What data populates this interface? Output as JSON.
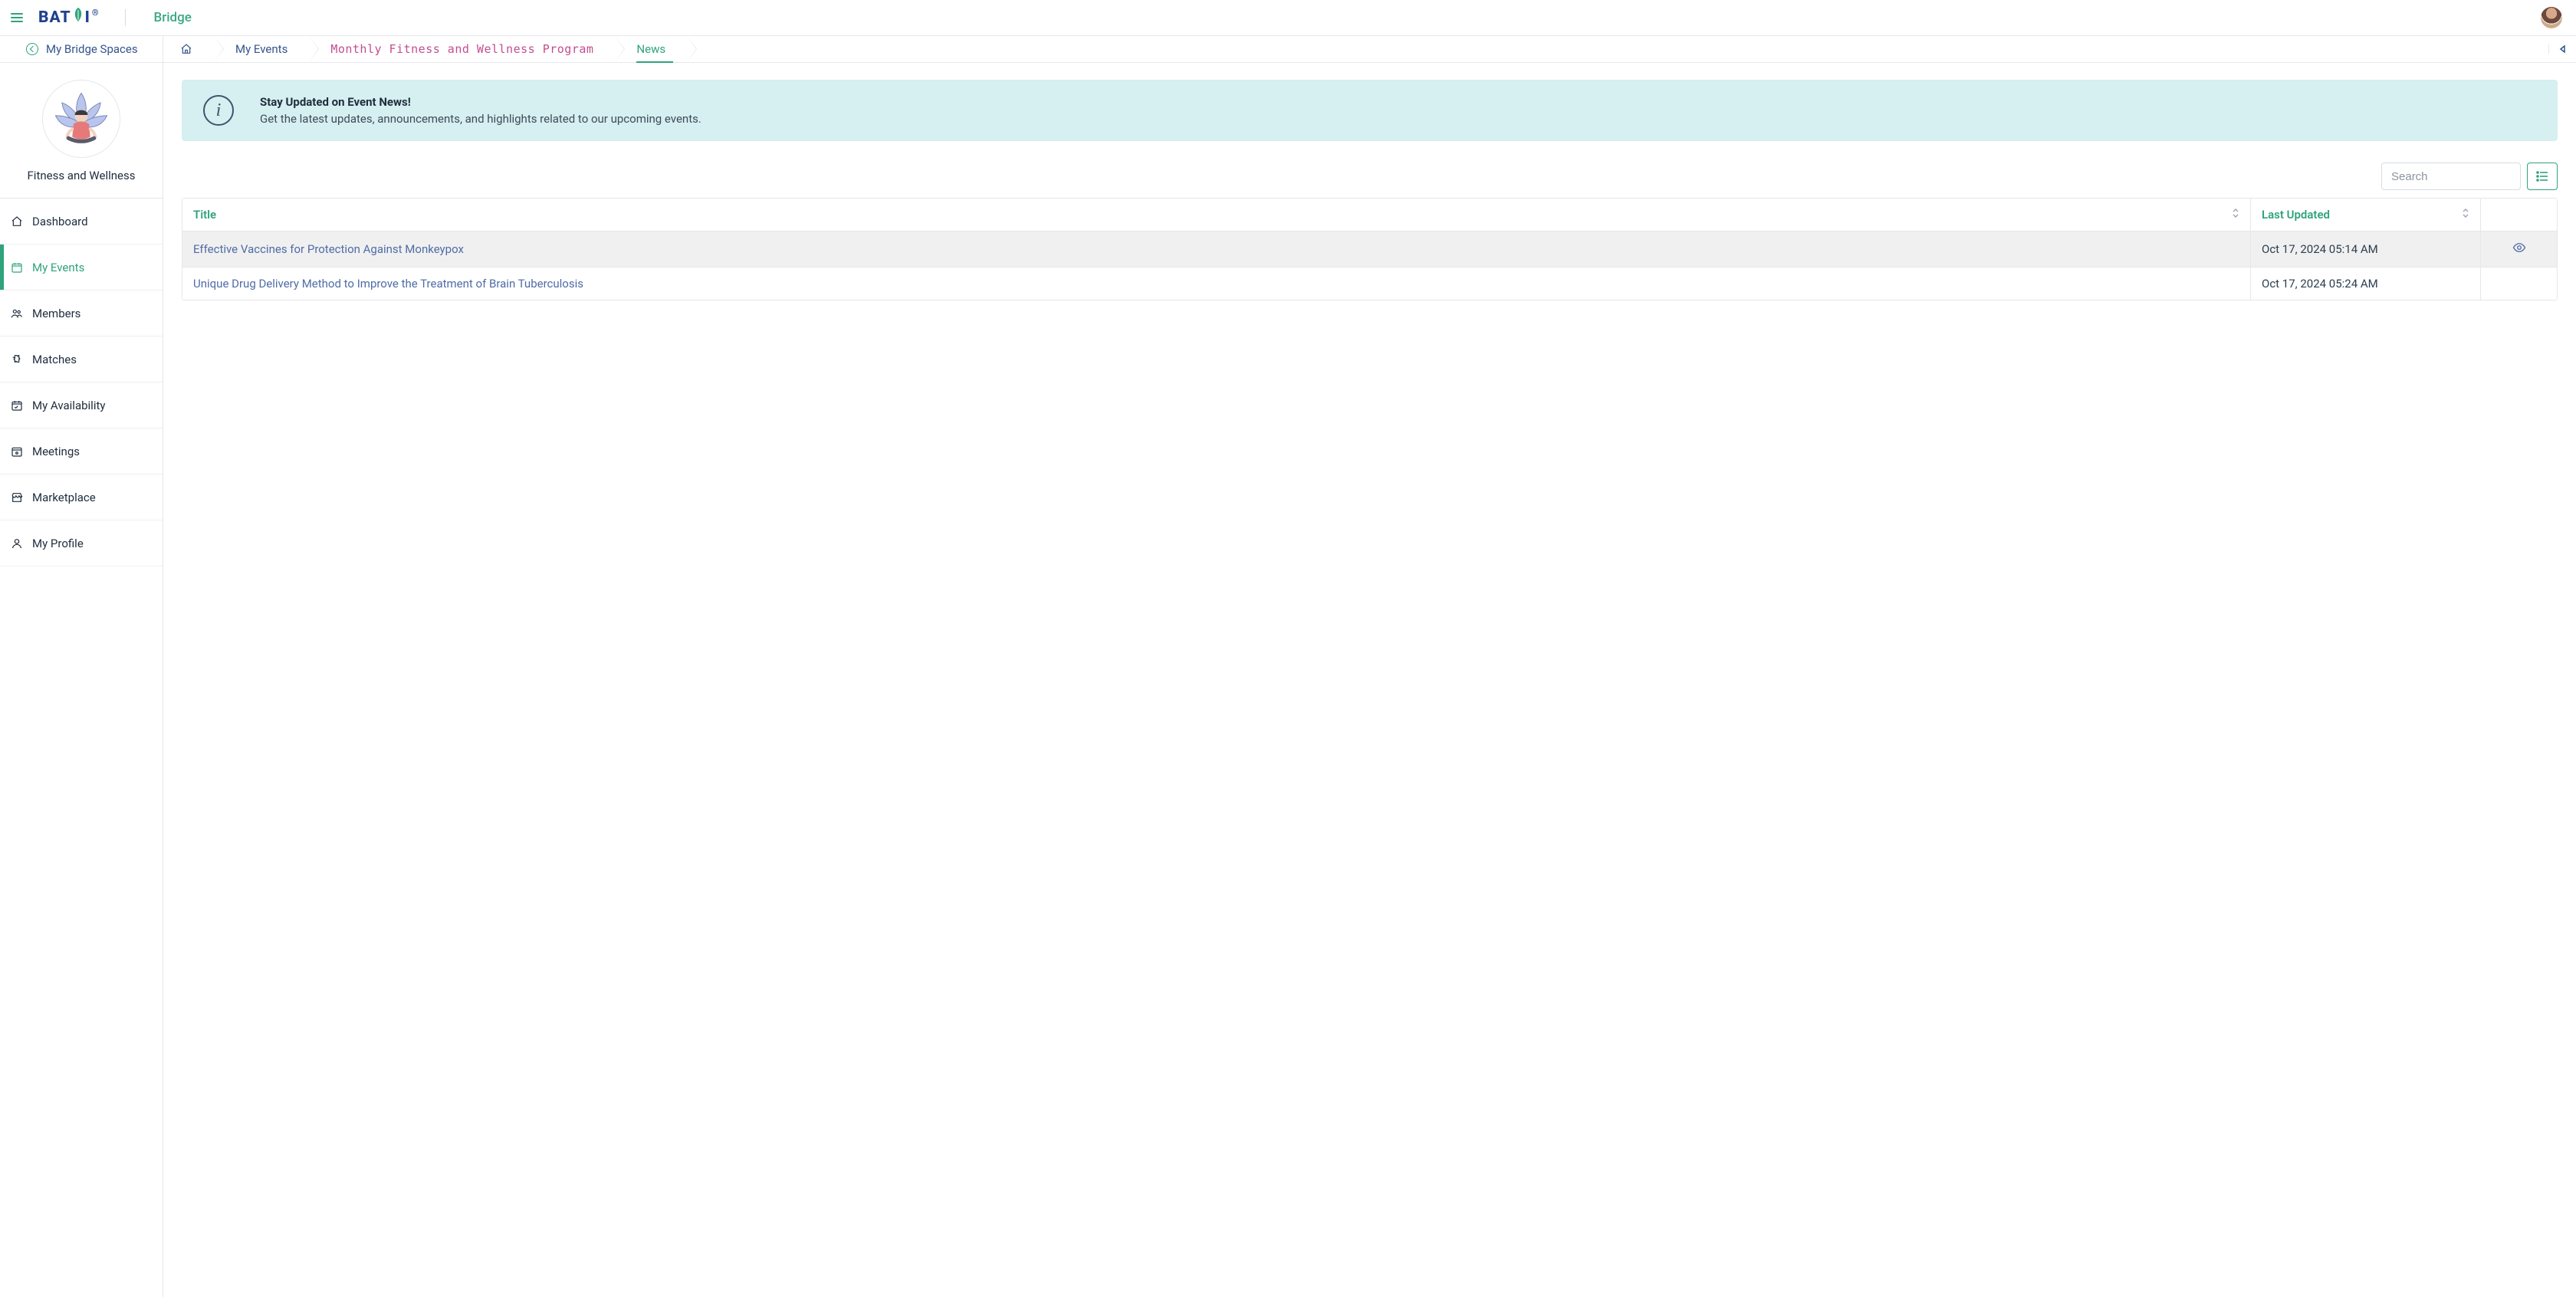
{
  "header": {
    "logo_text_prefix": "BAT",
    "logo_text_suffix": "I",
    "logo_registered": "®",
    "app_name": "Bridge"
  },
  "backlink": {
    "label": "My Bridge Spaces"
  },
  "breadcrumb": {
    "items": [
      {
        "label": "",
        "kind": "home"
      },
      {
        "label": "My Events",
        "kind": "link"
      },
      {
        "label": "Monthly Fitness and Wellness Program",
        "kind": "mono"
      },
      {
        "label": "News",
        "kind": "active"
      }
    ]
  },
  "sidebar": {
    "profile_name": "Fitness and Wellness",
    "items": [
      {
        "label": "Dashboard",
        "icon": "home-icon",
        "active": false
      },
      {
        "label": "My Events",
        "icon": "calendar-icon",
        "active": true
      },
      {
        "label": "Members",
        "icon": "users-icon",
        "active": false
      },
      {
        "label": "Matches",
        "icon": "puzzle-icon",
        "active": false
      },
      {
        "label": "My Availability",
        "icon": "availability-icon",
        "active": false
      },
      {
        "label": "Meetings",
        "icon": "meetings-icon",
        "active": false
      },
      {
        "label": "Marketplace",
        "icon": "store-icon",
        "active": false
      },
      {
        "label": "My Profile",
        "icon": "profile-icon",
        "active": false
      }
    ]
  },
  "info_banner": {
    "title": "Stay Updated on Event News!",
    "body": "Get the latest updates, announcements, and highlights related to our upcoming events."
  },
  "search": {
    "placeholder": "Search"
  },
  "table": {
    "columns": {
      "title": "Title",
      "last_updated": "Last Updated"
    },
    "rows": [
      {
        "title": "Effective Vaccines for Protection Against Monkeypox",
        "last_updated": "Oct 17, 2024 05:14 AM",
        "hovered": true,
        "has_view": true
      },
      {
        "title": "Unique Drug Delivery Method to Improve the Treatment of Brain Tuberculosis",
        "last_updated": "Oct 17, 2024 05:24 AM",
        "hovered": false,
        "has_view": false
      }
    ]
  }
}
